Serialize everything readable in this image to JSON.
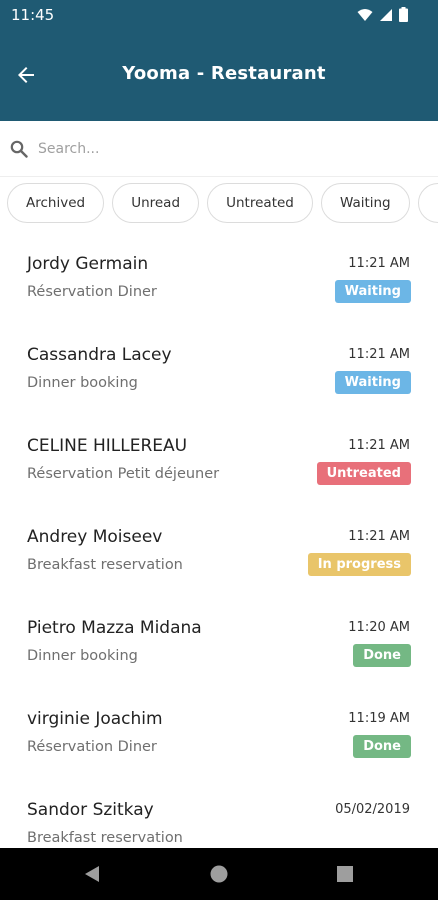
{
  "status_bar": {
    "time": "11:45",
    "icons": [
      "wifi-icon",
      "cellular-icon",
      "battery-icon"
    ]
  },
  "header": {
    "title": "Yooma - Restaurant",
    "back_icon": "arrow-left-icon",
    "background_color": "#1f5a73"
  },
  "search": {
    "placeholder": "Search...",
    "value": "",
    "icon": "search-icon"
  },
  "filters": [
    {
      "label": "Archived"
    },
    {
      "label": "Unread"
    },
    {
      "label": "Untreated"
    },
    {
      "label": "Waiting"
    },
    {
      "label": ""
    }
  ],
  "status_colors": {
    "Waiting": "#6cb6e6",
    "Untreated": "#e8707a",
    "In progress": "#e9c56a",
    "Done": "#74b884"
  },
  "conversations": [
    {
      "name": "Jordy Germain",
      "subject": "Réservation Diner",
      "time": "11:21 AM",
      "status": "Waiting"
    },
    {
      "name": "Cassandra Lacey",
      "subject": "Dinner booking",
      "time": "11:21 AM",
      "status": "Waiting"
    },
    {
      "name": "CELINE HILLEREAU",
      "subject": "Réservation Petit déjeuner",
      "time": "11:21 AM",
      "status": "Untreated"
    },
    {
      "name": "Andrey Moiseev",
      "subject": "Breakfast reservation",
      "time": "11:21 AM",
      "status": "In progress"
    },
    {
      "name": "Pietro Mazza Midana",
      "subject": "Dinner booking",
      "time": "11:20 AM",
      "status": "Done"
    },
    {
      "name": "virginie Joachim",
      "subject": "Réservation Diner",
      "time": "11:19 AM",
      "status": "Done"
    },
    {
      "name": "Sandor Szitkay",
      "subject": "Breakfast reservation",
      "time": "05/02/2019",
      "status": ""
    }
  ],
  "nav_bar": [
    "back-triangle-icon",
    "home-circle-icon",
    "recents-square-icon"
  ]
}
